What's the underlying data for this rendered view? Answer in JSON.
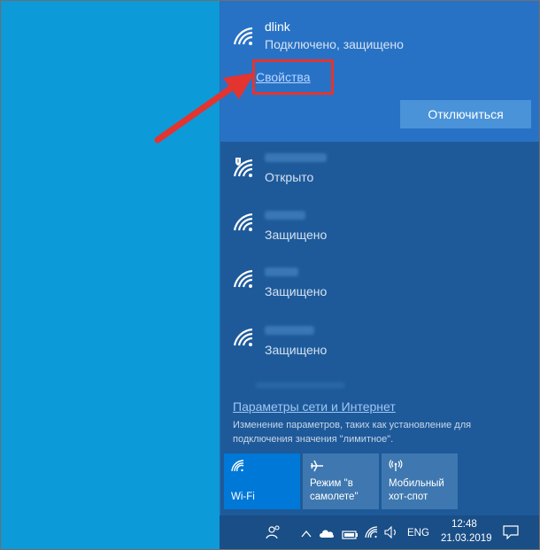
{
  "connected_network": {
    "name": "dlink",
    "status": "Подключено, защищено",
    "properties_label": "Свойства",
    "disconnect_label": "Отключиться"
  },
  "networks": [
    {
      "status": "Открыто",
      "security": "open"
    },
    {
      "status": "Защищено",
      "security": "secured"
    },
    {
      "status": "Защищено",
      "security": "secured"
    },
    {
      "status": "Защищено",
      "security": "secured"
    }
  ],
  "settings": {
    "link_label": "Параметры сети и Интернет",
    "description": "Изменение параметров, таких как установление для подключения значения \"лимитное\"."
  },
  "quick_actions": [
    {
      "label": "Wi-Fi",
      "icon": "wifi-icon",
      "active": true
    },
    {
      "label": "Режим \"в\nсамолете\"",
      "icon": "airplane-icon",
      "active": false
    },
    {
      "label": "Мобильный\nхот-спот",
      "icon": "hotspot-icon",
      "active": false
    }
  ],
  "taskbar": {
    "language": "ENG",
    "time": "12:48",
    "date": "21.03.2019"
  },
  "colors": {
    "flyout_bg": "#1e5a9a",
    "connected_bg": "#2872c6",
    "accent": "#0078d7",
    "highlight_box": "#e4342f"
  }
}
